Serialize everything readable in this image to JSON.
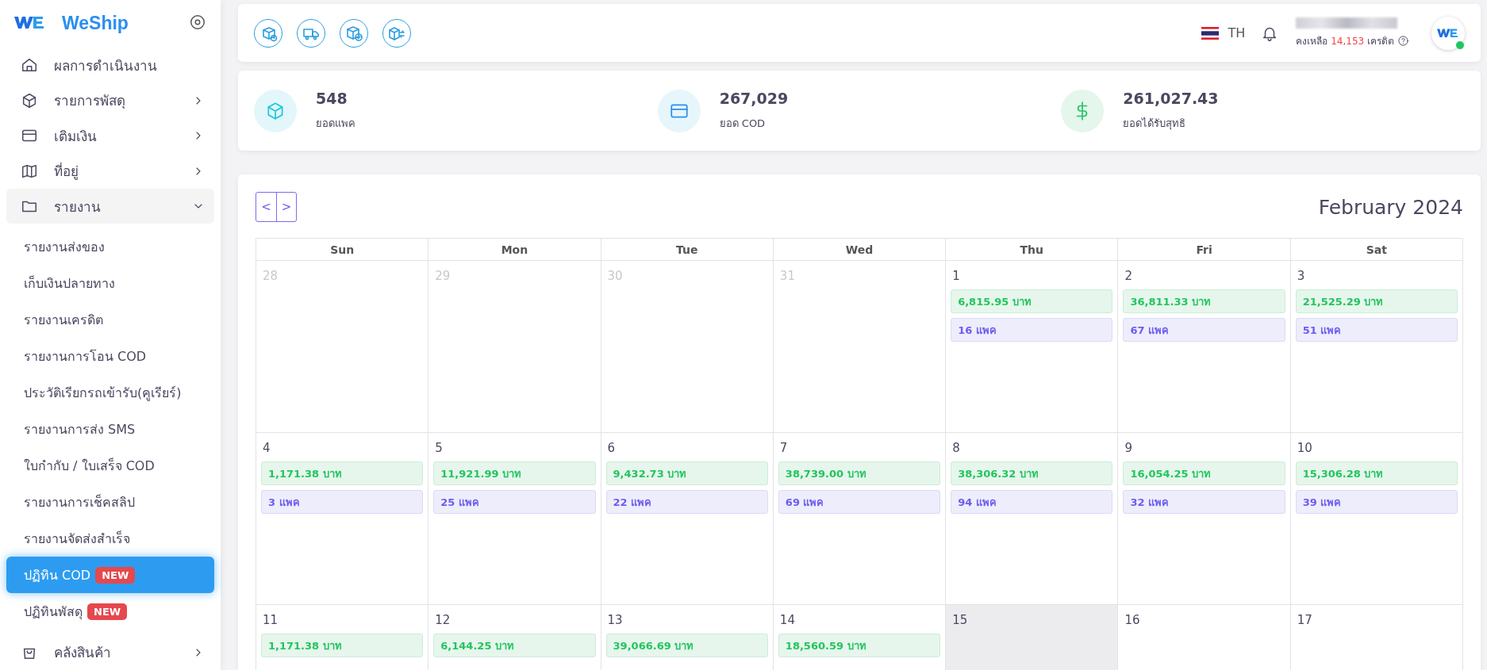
{
  "sidebar": {
    "brand": "WeShip",
    "items": [
      {
        "label": "ผลการดำเนินงาน",
        "expandable": false,
        "expanded": false
      },
      {
        "label": "รายการพัสดุ",
        "expandable": true,
        "expanded": false
      },
      {
        "label": "เติมเงิน",
        "expandable": true,
        "expanded": false
      },
      {
        "label": "ที่อยู่",
        "expandable": true,
        "expanded": false
      },
      {
        "label": "รายงาน",
        "expandable": true,
        "expanded": true,
        "children": [
          {
            "label": "รายงานส่งของ",
            "selected": false
          },
          {
            "label": "เก็บเงินปลายทาง",
            "selected": false
          },
          {
            "label": "รายงานเครดิต",
            "selected": false
          },
          {
            "label": "รายงานการโอน COD",
            "selected": false
          },
          {
            "label": "ประวัติเรียกรถเข้ารับ(คูเรียร์)",
            "selected": false
          },
          {
            "label": "รายงานการส่ง SMS",
            "selected": false
          },
          {
            "label": "ใบกำกับ / ใบเสร็จ COD",
            "selected": false
          },
          {
            "label": "รายงานการเช็คสลิป",
            "selected": false
          },
          {
            "label": "รายงานจัดส่งสำเร็จ",
            "selected": false
          },
          {
            "label": "ปฏิทิน COD",
            "badge": "NEW",
            "selected": true
          },
          {
            "label": "ปฏิทินพัสดุ",
            "badge": "NEW",
            "selected": false
          }
        ]
      },
      {
        "label": "คลังสินค้า",
        "expandable": true,
        "expanded": false
      }
    ]
  },
  "topbar": {
    "language": "TH",
    "credit_prefix": "คงเหลือ",
    "credit_amount": "14,153",
    "credit_suffix": "เครดิต"
  },
  "stats": [
    {
      "value": "548",
      "label": "ยอดแพค"
    },
    {
      "value": "267,029",
      "label": "ยอด COD"
    },
    {
      "value": "261,027.43",
      "label": "ยอดได้รับสุทธิ"
    }
  ],
  "calendar": {
    "prev": "<",
    "next": ">",
    "title": "February 2024",
    "weekdays": [
      "Sun",
      "Mon",
      "Tue",
      "Wed",
      "Thu",
      "Fri",
      "Sat"
    ],
    "weeks": [
      [
        {
          "day": "28",
          "muted": true,
          "today": false
        },
        {
          "day": "29",
          "muted": true,
          "today": false
        },
        {
          "day": "30",
          "muted": true,
          "today": false
        },
        {
          "day": "31",
          "muted": true,
          "today": false
        },
        {
          "day": "1",
          "muted": false,
          "today": false,
          "amount": "6,815.95 บาท",
          "packs": "16 แพค"
        },
        {
          "day": "2",
          "muted": false,
          "today": false,
          "amount": "36,811.33 บาท",
          "packs": "67 แพค"
        },
        {
          "day": "3",
          "muted": false,
          "today": false,
          "amount": "21,525.29 บาท",
          "packs": "51 แพค"
        }
      ],
      [
        {
          "day": "4",
          "muted": false,
          "today": false,
          "amount": "1,171.38 บาท",
          "packs": "3 แพค"
        },
        {
          "day": "5",
          "muted": false,
          "today": false,
          "amount": "11,921.99 บาท",
          "packs": "25 แพค"
        },
        {
          "day": "6",
          "muted": false,
          "today": false,
          "amount": "9,432.73 บาท",
          "packs": "22 แพค"
        },
        {
          "day": "7",
          "muted": false,
          "today": false,
          "amount": "38,739.00 บาท",
          "packs": "69 แพค"
        },
        {
          "day": "8",
          "muted": false,
          "today": false,
          "amount": "38,306.32 บาท",
          "packs": "94 แพค"
        },
        {
          "day": "9",
          "muted": false,
          "today": false,
          "amount": "16,054.25 บาท",
          "packs": "32 แพค"
        },
        {
          "day": "10",
          "muted": false,
          "today": false,
          "amount": "15,306.28 บาท",
          "packs": "39 แพค"
        }
      ],
      [
        {
          "day": "11",
          "muted": false,
          "today": false,
          "amount": "1,171.38 บาท"
        },
        {
          "day": "12",
          "muted": false,
          "today": false,
          "amount": "6,144.25 บาท"
        },
        {
          "day": "13",
          "muted": false,
          "today": false,
          "amount": "39,066.69 บาท"
        },
        {
          "day": "14",
          "muted": false,
          "today": false,
          "amount": "18,560.59 บาท"
        },
        {
          "day": "15",
          "muted": false,
          "today": true
        },
        {
          "day": "16",
          "muted": false,
          "today": false
        },
        {
          "day": "17",
          "muted": false,
          "today": false
        }
      ]
    ]
  }
}
